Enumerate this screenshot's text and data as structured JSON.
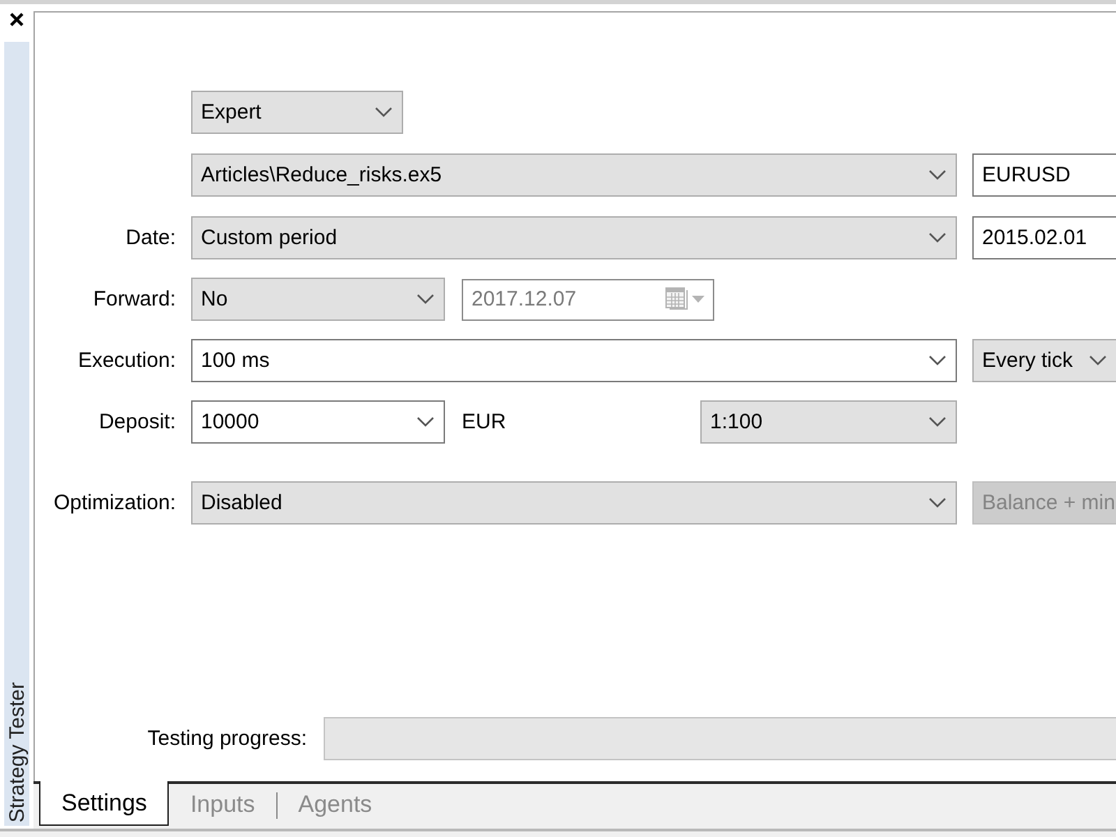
{
  "window": {
    "side_title": "Strategy Tester"
  },
  "program": {
    "type": "Expert",
    "file": "Articles\\Reduce_risks.ex5",
    "symbol": "EURUSD"
  },
  "date": {
    "label": "Date:",
    "period": "Custom period",
    "start": "2015.02.01"
  },
  "forward": {
    "label": "Forward:",
    "mode": "No",
    "date": "2017.12.07",
    "date_disabled": true
  },
  "execution": {
    "label": "Execution:",
    "delay": "100 ms",
    "modeling": "Every tick"
  },
  "deposit": {
    "label": "Deposit:",
    "amount": "10000",
    "currency": "EUR",
    "leverage": "1:100"
  },
  "optimization": {
    "label": "Optimization:",
    "mode": "Disabled",
    "criterion": "Balance + min",
    "criterion_disabled": true
  },
  "progress": {
    "label": "Testing progress:",
    "level": 0
  },
  "tabs": [
    {
      "label": "Settings",
      "selected": true
    },
    {
      "label": "Inputs",
      "selected": false
    },
    {
      "label": "Agents",
      "selected": false
    }
  ]
}
